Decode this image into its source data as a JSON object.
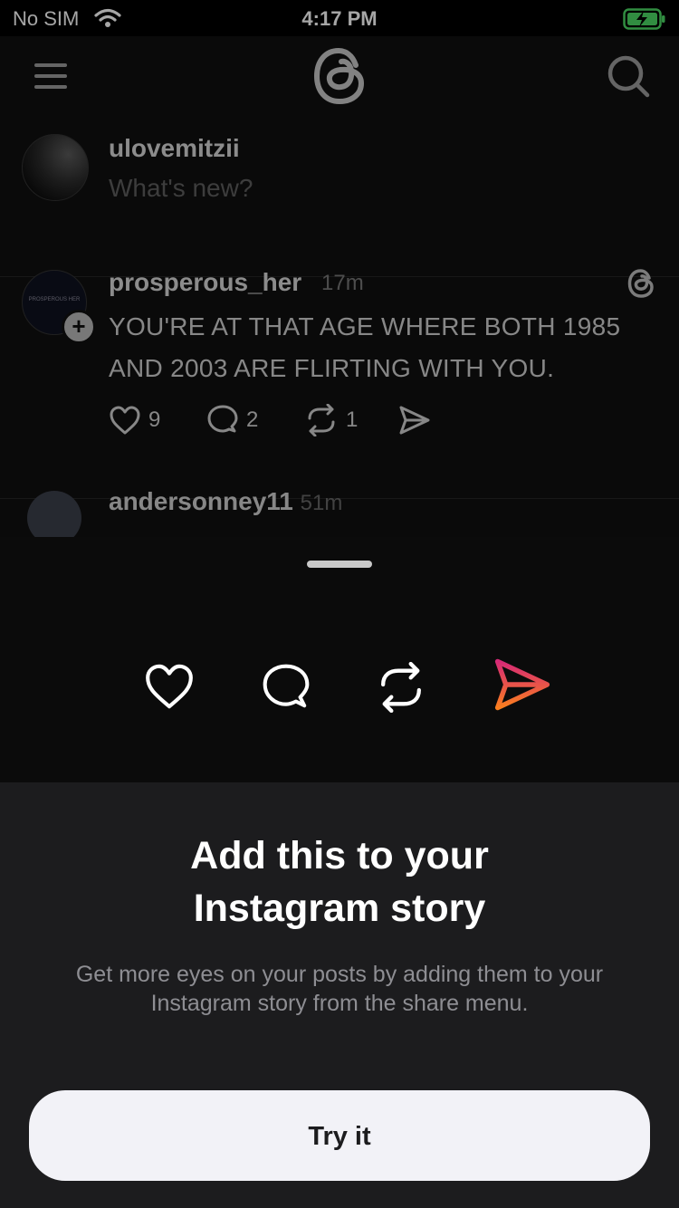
{
  "status_bar": {
    "carrier": "No SIM",
    "time": "4:17 PM"
  },
  "header": {
    "menu_icon": "hamburger-icon",
    "logo_icon": "threads-logo-icon",
    "search_icon": "search-icon"
  },
  "compose": {
    "username": "ulovemitzii",
    "placeholder": "What's new?"
  },
  "post": {
    "username": "prosperous_her",
    "time": "17m",
    "avatar_text": "PROSPEROUS HER",
    "text": "YOU'RE AT THAT AGE WHERE BOTH 1985 AND 2003 ARE FLIRTING WITH YOU.",
    "likes": "9",
    "comments": "2",
    "reposts": "1"
  },
  "next_post": {
    "username": "andersonney11",
    "time": "51m"
  },
  "sheet": {
    "headline_line1": "Add this to your",
    "headline_line2": "Instagram story",
    "description": "Get more eyes on your posts by adding them to your Instagram story from the share menu.",
    "button_label": "Try it",
    "send_gradient": [
      "#d62976",
      "#fa7e1e"
    ]
  }
}
